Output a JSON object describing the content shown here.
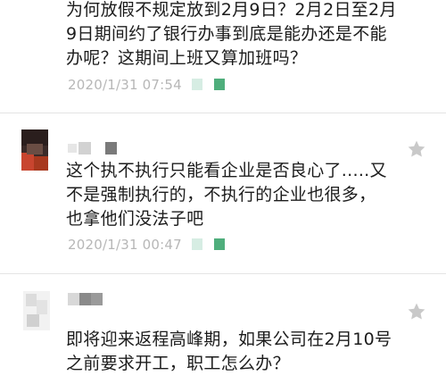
{
  "comments": [
    {
      "lines": [
        "为何放假不规定放到2月9日？2月2日至2月",
        "9日期间约了银行办事到底是能办还是不能",
        "办呢？这期间上班又算加班吗？"
      ],
      "timestamp": "2020/1/31 07:54",
      "badge_colors": [
        "#d6ede3",
        "#4fae7c"
      ]
    },
    {
      "lines": [
        "这个执不执行只能看企业是否良心了.....又",
        "不是强制执行的，不执行的企业也很多，",
        "也拿他们没法子吧"
      ],
      "timestamp": "2020/1/31 00:47",
      "badge_colors": [
        "#d6ede3",
        "#4fae7c"
      ]
    },
    {
      "lines": [
        "即将迎来返程高峰期，如果公司在2月10号",
        "之前要求开工，职工怎么办？"
      ]
    }
  ],
  "colors": {
    "text": "#1c1c1c",
    "meta": "#b7b7b7",
    "divider": "#e4e4e4",
    "star": "#c9c9c9",
    "badge_green": "#4fae7c"
  },
  "icons": {
    "favorite": "star-icon"
  }
}
